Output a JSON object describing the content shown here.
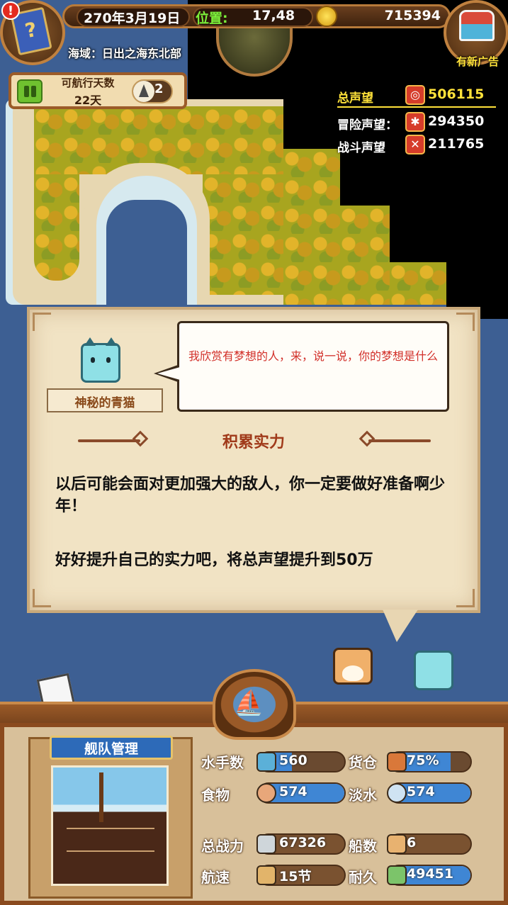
{
  "hud": {
    "date": "270年3月19日",
    "position_label": "位置:",
    "position_value": "17,48",
    "gold": "715394",
    "sea_region": "海域：日出之海东北部",
    "ad_label": "有新广告",
    "alert_mark": "!"
  },
  "sailing": {
    "label": "可航行天数",
    "days": "22天",
    "compass_count": "2"
  },
  "reputation": {
    "total_label": "总声望",
    "total_value": "506115",
    "adventure_label": "冒险声望：",
    "adventure_value": "294350",
    "battle_label": "战斗声望",
    "battle_value": "211765"
  },
  "dialog": {
    "npc_name": "神秘的青猫",
    "speech": "我欣赏有梦想的人，来，说一说，你的梦想是什么",
    "task_title": "积累实力",
    "task_line1": "以后可能会面对更加强大的敌人，你一定要做好准备啊少年！",
    "task_line2": "好好提升自己的实力吧，将总声望提升到50万"
  },
  "fleet": {
    "title": "舰队管理",
    "stats": {
      "sailors_label": "水手数",
      "sailors_value": "560",
      "sailors_fill": 0.38,
      "cargo_label": "货仓",
      "cargo_value": "75%",
      "cargo_fill": 0.75,
      "food_label": "食物",
      "food_value": "574",
      "food_fill": 1.0,
      "water_label": "淡水",
      "water_value": "574",
      "water_fill": 1.0,
      "power_label": "总战力",
      "power_value": "67326",
      "ships_label": "船数",
      "ships_value": "6",
      "speed_label": "航速",
      "speed_value": "15节",
      "durability_label": "耐久",
      "durability_value": "49451",
      "durability_fill": 1.0
    }
  },
  "colors": {
    "sea": "#3d5f93",
    "forest": "#a8a51f",
    "sand": "#e7d7b1",
    "bar_fill": "#3f86d4",
    "reputation_total": "#ffe23a",
    "speech_text": "#d2302a"
  },
  "icons": [
    "quest-book-icon",
    "alert-icon",
    "gold-coin-icon",
    "treasure-chest-icon",
    "pause-icon",
    "compass-icon",
    "reputation-icon",
    "adventure-icon",
    "battle-icon",
    "sailor-icon",
    "cargo-icon",
    "meat-icon",
    "water-jug-icon",
    "crossed-swords-icon",
    "ship-icon",
    "speed-ship-icon",
    "durability-icon"
  ]
}
